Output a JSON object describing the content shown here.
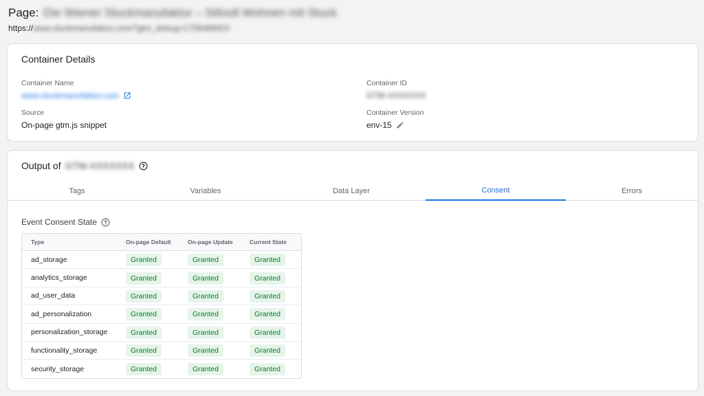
{
  "page": {
    "title_prefix": "Page:",
    "title_blurred": "Die Wiener Stuckmanufaktur – Stilvoll Wohnen mit Stuck",
    "url_prefix": "https://",
    "url_blurred": "www.stuckmanufaktur.com/?gtm_debug=1708466923"
  },
  "container_details": {
    "title": "Container Details",
    "name_label": "Container Name",
    "name_value": "www.stuckmanufaktur.com",
    "id_label": "Container ID",
    "id_value": "GTM-XXXXXXX",
    "source_label": "Source",
    "source_value": "On-page gtm.js snippet",
    "version_label": "Container Version",
    "version_value": "env-15"
  },
  "output": {
    "title_prefix": "Output of",
    "title_blurred": "GTM-XXXXXXX",
    "tabs": [
      {
        "label": "Tags",
        "active": false
      },
      {
        "label": "Variables",
        "active": false
      },
      {
        "label": "Data Layer",
        "active": false
      },
      {
        "label": "Consent",
        "active": true
      },
      {
        "label": "Errors",
        "active": false
      }
    ],
    "section_title": "Event Consent State",
    "table": {
      "headers": [
        "Type",
        "On-page Default",
        "On-page Update",
        "Current State"
      ],
      "rows": [
        [
          "ad_storage",
          "Granted",
          "Granted",
          "Granted"
        ],
        [
          "analytics_storage",
          "Granted",
          "Granted",
          "Granted"
        ],
        [
          "ad_user_data",
          "Granted",
          "Granted",
          "Granted"
        ],
        [
          "ad_personalization",
          "Granted",
          "Granted",
          "Granted"
        ],
        [
          "personalization_storage",
          "Granted",
          "Granted",
          "Granted"
        ],
        [
          "functionality_storage",
          "Granted",
          "Granted",
          "Granted"
        ],
        [
          "security_storage",
          "Granted",
          "Granted",
          "Granted"
        ]
      ]
    }
  },
  "colors": {
    "accent": "#1a73e8",
    "granted_bg": "#e6f4ea",
    "granted_text": "#137333"
  },
  "icons": {
    "external_link": "open-in-new-icon",
    "edit": "pencil-icon",
    "help": "help-circle-icon"
  }
}
